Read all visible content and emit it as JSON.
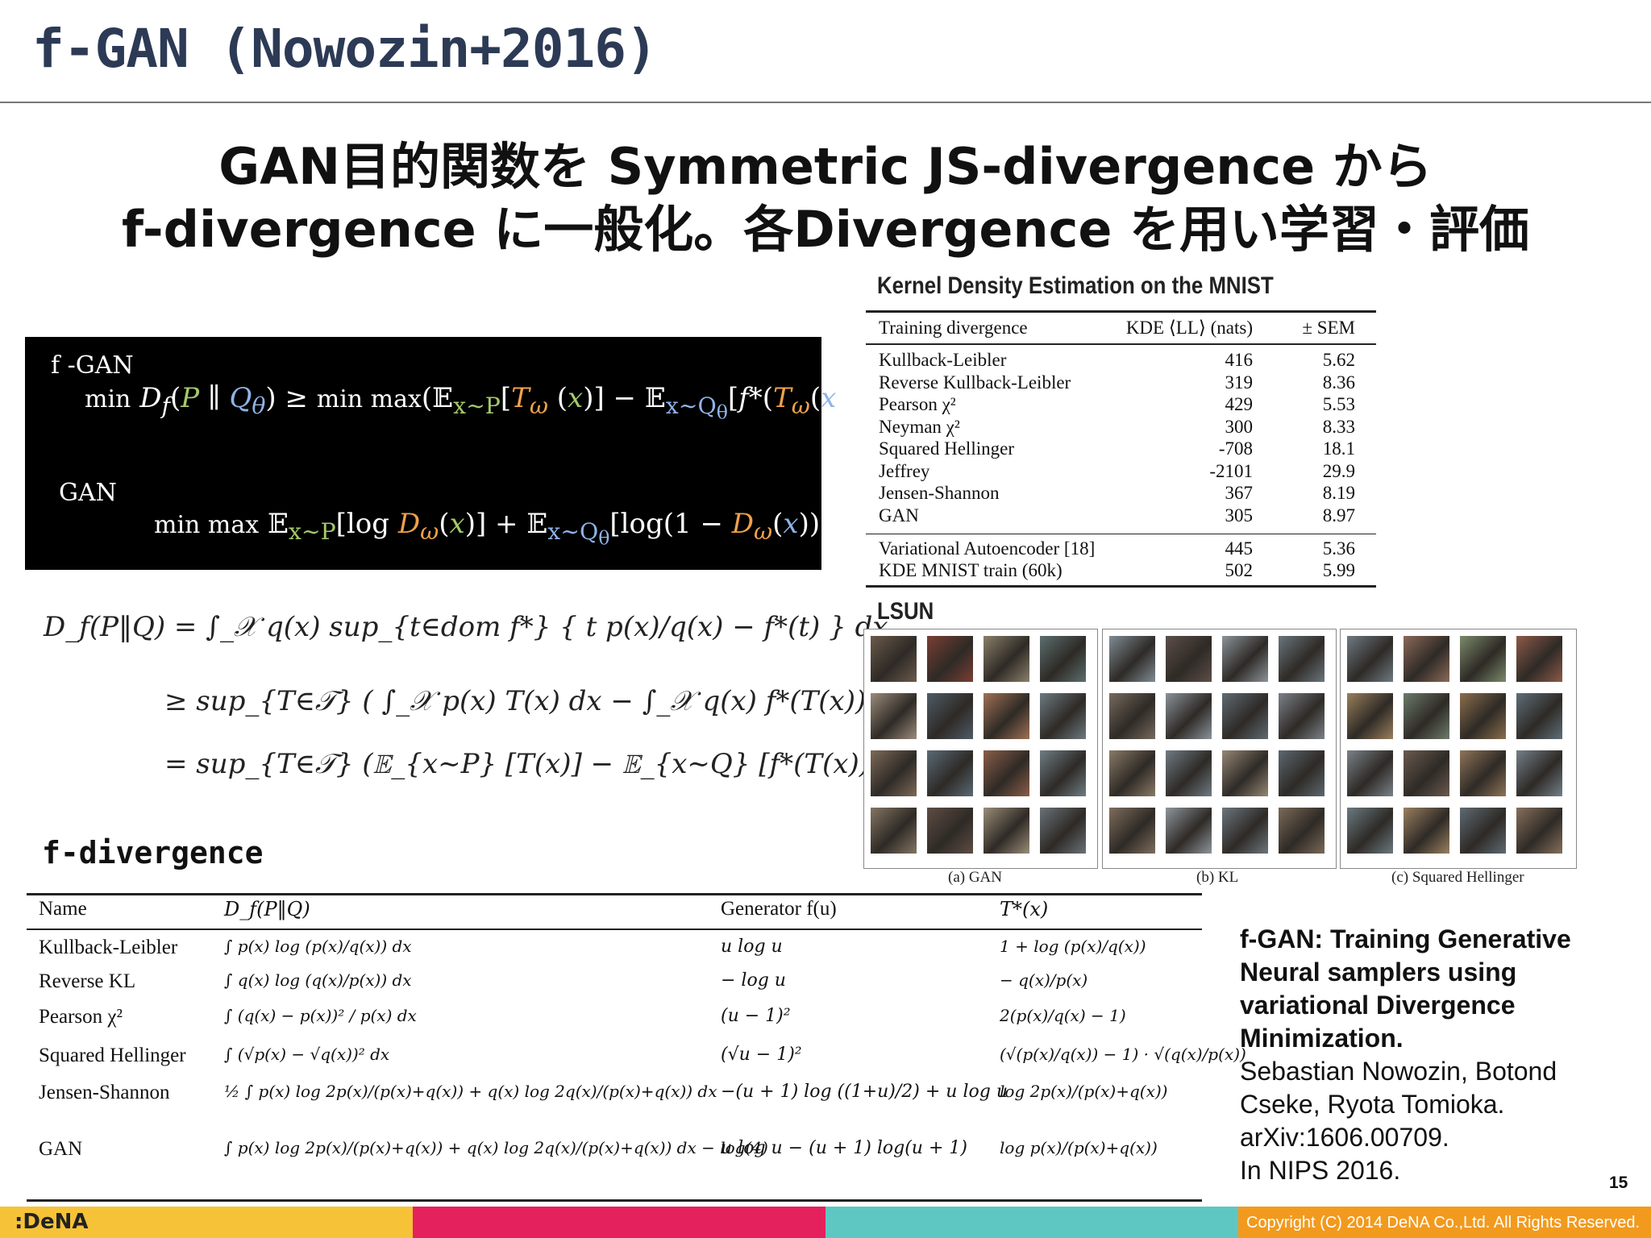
{
  "title": "f-GAN (Nowozin+2016)",
  "headline": {
    "line1": "GAN目的関数を Symmetric JS-divergence から",
    "line2": "f-divergence に一般化。各Divergence を用い学習・評価"
  },
  "fgan_panel": {
    "label_fgan": "f -GAN",
    "formula_fgan": "min D_f(P ∥ Q_θ) ≥ min max(E_{x~P}[T_ω(x)] − E_{x~Q_θ}[f*(T_ω(x))])",
    "label_gan": "GAN",
    "formula_gan": "min max E_{x~P}[log D_ω(x)] + E_{x~Q_θ}[log(1 − D_ω(x))]"
  },
  "df_math": {
    "line1": "D_f(P‖Q) = ∫_𝒳 q(x) sup_{t∈dom f*} { t p(x)/q(x) − f*(t) } dx",
    "line2": "≥ sup_{T∈𝒯} ( ∫_𝒳 p(x) T(x) dx − ∫_𝒳 q(x) f*(T(x)) dx )",
    "line3": "= sup_{T∈𝒯} (𝔼_{x∼P} [T(x)] − 𝔼_{x∼Q} [f*(T(x))]) ,"
  },
  "kde": {
    "title": "Kernel Density Estimation on the MNIST",
    "headers": [
      "Training divergence",
      "KDE ⟨LL⟩ (nats)",
      "± SEM"
    ],
    "rows": [
      [
        "Kullback-Leibler",
        "416",
        "5.62"
      ],
      [
        "Reverse Kullback-Leibler",
        "319",
        "8.36"
      ],
      [
        "Pearson χ²",
        "429",
        "5.53"
      ],
      [
        "Neyman χ²",
        "300",
        "8.33"
      ],
      [
        "Squared Hellinger",
        "-708",
        "18.1"
      ],
      [
        "Jeffrey",
        "-2101",
        "29.9"
      ],
      [
        "Jensen-Shannon",
        "367",
        "8.19"
      ],
      [
        "GAN",
        "305",
        "8.97"
      ]
    ],
    "extra_rows": [
      [
        "Variational Autoencoder [18]",
        "445",
        "5.36"
      ],
      [
        "KDE MNIST train (60k)",
        "502",
        "5.99"
      ]
    ]
  },
  "lsun": {
    "title": "LSUN",
    "captions": [
      "(a) GAN",
      "(b) KL",
      "(c) Squared Hellinger"
    ],
    "thumb_colors": [
      [
        "#6b5a4a",
        "#7a3f34",
        "#8a7f6a",
        "#5c6f6e",
        "#9b8c7a",
        "#4f5b66",
        "#a07055",
        "#6e7a80",
        "#7d6a58",
        "#5a6a75",
        "#8b5e48",
        "#6f7d84",
        "#847563",
        "#5e4d44",
        "#9a8d78",
        "#6a7278"
      ],
      [
        "#7f8c94",
        "#5d4e48",
        "#8c9399",
        "#6a757c",
        "#766a5e",
        "#8b929a",
        "#5f6b73",
        "#7c8188",
        "#8a7a66",
        "#6f7b83",
        "#958775",
        "#5c6870",
        "#7e6e5c",
        "#8f969c",
        "#6c767e",
        "#7a6a58"
      ],
      [
        "#6f7a82",
        "#8a6a58",
        "#7b8a6a",
        "#8c5a48",
        "#9a7f5c",
        "#6d7c6a",
        "#8a6e4c",
        "#5f6e78",
        "#7a8288",
        "#6a5a4e",
        "#8e7458",
        "#748088",
        "#6b7a80",
        "#9a8060",
        "#5f6a72",
        "#86705c"
      ]
    ]
  },
  "fdiv": {
    "title": "f-divergence",
    "headers": [
      "Name",
      "D_f(P‖Q)",
      "Generator f(u)",
      "T*(x)"
    ],
    "rows": [
      [
        "Kullback-Leibler",
        "∫ p(x) log (p(x)/q(x)) dx",
        "u log u",
        "1 + log (p(x)/q(x))"
      ],
      [
        "Reverse KL",
        "∫ q(x) log (q(x)/p(x)) dx",
        "− log u",
        "− q(x)/p(x)"
      ],
      [
        "Pearson χ²",
        "∫ (q(x) − p(x))² / p(x) dx",
        "(u − 1)²",
        "2(p(x)/q(x) − 1)"
      ],
      [
        "Squared Hellinger",
        "∫ (√p(x) − √q(x))² dx",
        "(√u − 1)²",
        "(√(p(x)/q(x)) − 1) · √(q(x)/p(x))"
      ],
      [
        "Jensen-Shannon",
        "½ ∫ p(x) log 2p(x)/(p(x)+q(x)) + q(x) log 2q(x)/(p(x)+q(x)) dx",
        "−(u + 1) log ((1+u)/2) + u log u",
        "log 2p(x)/(p(x)+q(x))"
      ],
      [
        "GAN",
        "∫ p(x) log 2p(x)/(p(x)+q(x)) + q(x) log 2q(x)/(p(x)+q(x)) dx − log(4)",
        "u log u − (u + 1) log(u + 1)",
        "log p(x)/(p(x)+q(x))"
      ]
    ]
  },
  "citation": {
    "title": "f-GAN: Training Generative Neural samplers using variational Divergence Minimization.",
    "authors": "Sebastian Nowozin, Botond Cseke, Ryota Tomioka.",
    "arxiv": "arXiv:1606.00709.",
    "venue": "In NIPS 2016."
  },
  "page_number": "15",
  "footer": {
    "logo": ":DeNA",
    "copyright": "Copyright (C) 2014 DeNA Co.,Ltd. All Rights Reserved.",
    "colors": [
      "#f6c238",
      "#e5215d",
      "#5fc7c2",
      "#f29a1e"
    ]
  }
}
